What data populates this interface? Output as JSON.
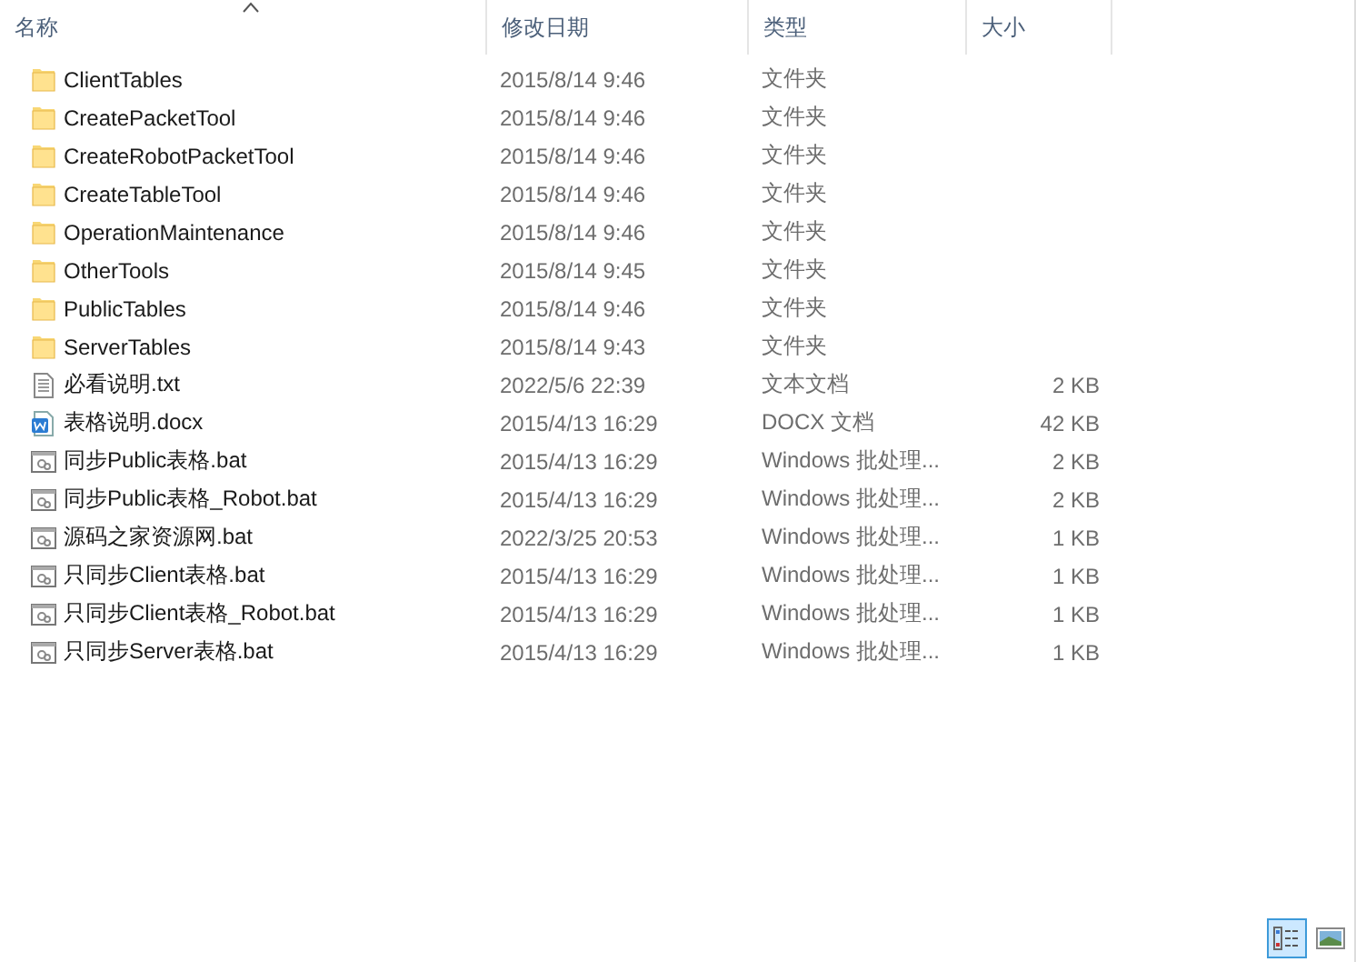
{
  "columns": [
    {
      "label": "名称",
      "sorted": true
    },
    {
      "label": "修改日期",
      "sorted": false
    },
    {
      "label": "类型",
      "sorted": false
    },
    {
      "label": "大小",
      "sorted": false
    }
  ],
  "files": [
    {
      "kind": "folder",
      "name": "ClientTables",
      "modified": "2015/8/14 9:46",
      "type": "文件夹"
    },
    {
      "kind": "folder",
      "name": "CreatePacketTool",
      "modified": "2015/8/14 9:46",
      "type": "文件夹"
    },
    {
      "kind": "folder",
      "name": "CreateRobotPacketTool",
      "modified": "2015/8/14 9:46",
      "type": "文件夹"
    },
    {
      "kind": "folder",
      "name": "CreateTableTool",
      "modified": "2015/8/14 9:46",
      "type": "文件夹"
    },
    {
      "kind": "folder",
      "name": "OperationMaintenance",
      "modified": "2015/8/14 9:46",
      "type": "文件夹"
    },
    {
      "kind": "folder",
      "name": "OtherTools",
      "modified": "2015/8/14 9:45",
      "type": "文件夹"
    },
    {
      "kind": "folder",
      "name": "PublicTables",
      "modified": "2015/8/14 9:46",
      "type": "文件夹"
    },
    {
      "kind": "folder",
      "name": "ServerTables",
      "modified": "2015/8/14 9:43",
      "type": "文件夹"
    },
    {
      "kind": "text",
      "name": "必看说明.txt",
      "modified": "2022/5/6 22:39",
      "type": "文本文档",
      "size": "2 KB"
    },
    {
      "kind": "word",
      "name": "表格说明.docx",
      "modified": "2015/4/13 16:29",
      "type": "DOCX 文档",
      "size": "42 KB"
    },
    {
      "kind": "batch",
      "name": "同步Public表格.bat",
      "modified": "2015/4/13 16:29",
      "type": "Windows 批处理...",
      "size": "2 KB"
    },
    {
      "kind": "batch",
      "name": "同步Public表格_Robot.bat",
      "modified": "2015/4/13 16:29",
      "type": "Windows 批处理...",
      "size": "2 KB"
    },
    {
      "kind": "batch",
      "name": "源码之家资源网.bat",
      "modified": "2022/3/25 20:53",
      "type": "Windows 批处理...",
      "size": "1 KB"
    },
    {
      "kind": "batch",
      "name": "只同步Client表格.bat",
      "modified": "2015/4/13 16:29",
      "type": "Windows 批处理...",
      "size": "1 KB"
    },
    {
      "kind": "batch",
      "name": "只同步Client表格_Robot.bat",
      "modified": "2015/4/13 16:29",
      "type": "Windows 批处理...",
      "size": "1 KB"
    },
    {
      "kind": "batch",
      "name": "只同步Server表格.bat",
      "modified": "2015/4/13 16:29",
      "type": "Windows 批处理...",
      "size": "1 KB"
    }
  ],
  "views": [
    {
      "kind": "details",
      "selected": true
    },
    {
      "kind": "large-icons",
      "selected": false
    }
  ]
}
